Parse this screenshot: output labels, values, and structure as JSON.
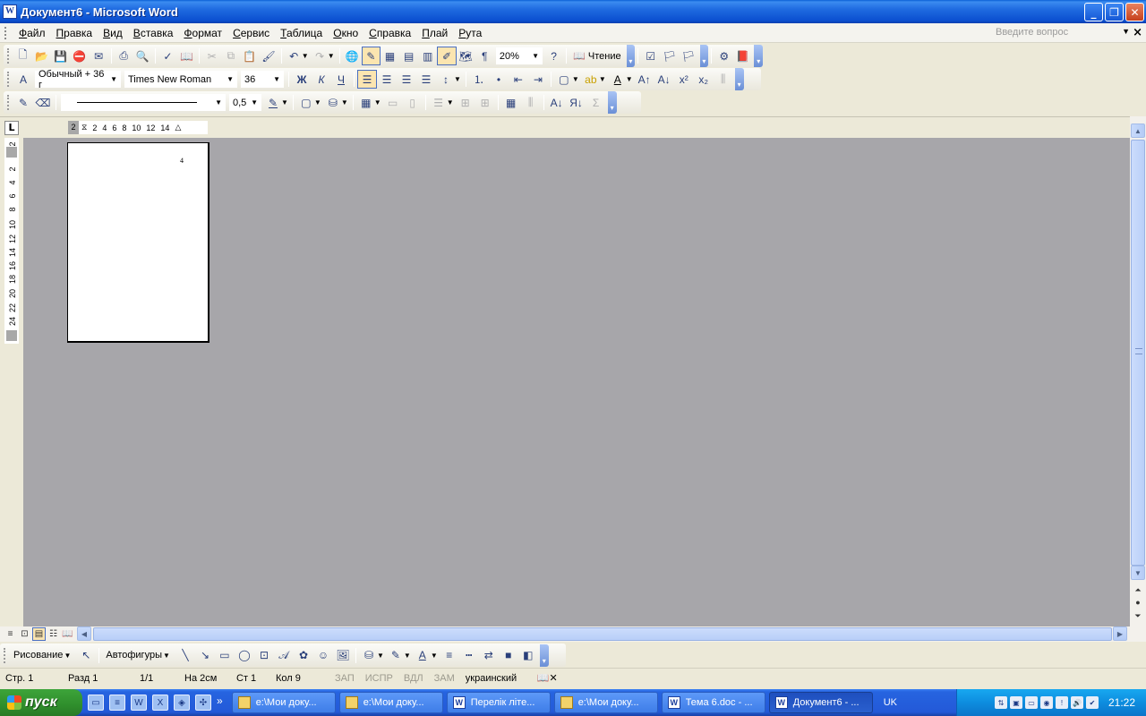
{
  "window": {
    "title": "Документ6 - Microsoft Word"
  },
  "menu": {
    "items": [
      "Файл",
      "Правка",
      "Вид",
      "Вставка",
      "Формат",
      "Сервис",
      "Таблица",
      "Окно",
      "Справка",
      "Плай",
      "Рута"
    ],
    "ask_placeholder": "Введите вопрос"
  },
  "standard_toolbar": {
    "zoom": "20%",
    "reading_label": "Чтение"
  },
  "format_toolbar": {
    "style": "Обычный + 36 г",
    "font": "Times New Roman",
    "size": "36"
  },
  "table_toolbar": {
    "line_weight": "0,5"
  },
  "ruler": {
    "labels": [
      "2",
      "2",
      "4",
      "6",
      "8",
      "10",
      "12",
      "14"
    ],
    "vertical_labels": [
      "2",
      "2",
      "4",
      "6",
      "8",
      "10",
      "12",
      "14",
      "16",
      "18",
      "20",
      "22",
      "24"
    ]
  },
  "document": {
    "page_text": "4"
  },
  "drawing_toolbar": {
    "draw_label": "Рисование",
    "autoshapes_label": "Автофигуры"
  },
  "status": {
    "page": "Стр. 1",
    "section": "Разд 1",
    "pages": "1/1",
    "at": "На 2см",
    "line": "Ст 1",
    "col": "Кол 9",
    "rec": "ЗАП",
    "trk": "ИСПР",
    "ext": "ВДЛ",
    "ovr": "ЗАМ",
    "language": "украинский"
  },
  "taskbar": {
    "start_label": "пуск",
    "tasks": [
      {
        "label": "e:\\Мои доку...",
        "icon": "folder-icon",
        "active": false
      },
      {
        "label": "e:\\Мои доку...",
        "icon": "folder-icon",
        "active": false
      },
      {
        "label": "Перелік літе...",
        "icon": "word-icon",
        "active": false
      },
      {
        "label": "e:\\Мои доку...",
        "icon": "folder-icon",
        "active": false
      },
      {
        "label": "Тема 6.doc - ...",
        "icon": "word-icon",
        "active": false
      },
      {
        "label": "Документ6 - ...",
        "icon": "word-icon",
        "active": true
      }
    ],
    "language": "UK",
    "clock": "21:22"
  },
  "colors": {
    "titlebar": "#0b4fd0",
    "workspace": "#a7a6aa",
    "taskbar": "#2359d8",
    "start_button": "#2f8e2c"
  }
}
